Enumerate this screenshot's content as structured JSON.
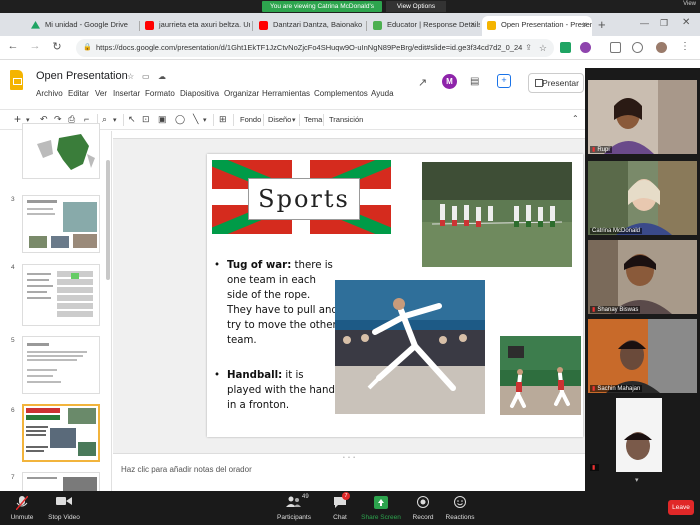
{
  "zoom_share": {
    "banner_text": "You are viewing Catrina McDonald's screen",
    "view_options": "View Options",
    "view_label": "View"
  },
  "tabs": [
    {
      "label": "Mi unidad - Google Drive",
      "icon": "google-drive-icon",
      "color": "#1fa463"
    },
    {
      "label": "jaurrieta eta axuri beltza. Urk",
      "icon": "youtube-icon",
      "color": "#ff0000"
    },
    {
      "label": "Dantzari Dantza, Baionako pe",
      "icon": "youtube-icon",
      "color": "#ff0000"
    },
    {
      "label": "Educator | Response Details",
      "icon": "educator-icon",
      "color": "#4caf50"
    },
    {
      "label": "Open Presentation - Present",
      "icon": "google-slides-icon",
      "color": "#f4b400"
    }
  ],
  "address_bar": {
    "url": "https://docs.google.com/presentation/d/1Ght1EkTF1JzCtvNoZjcFo4SHuqw9O-uInNgN89PeBrg/edit#slide=id.ge3f34cd7d2_0_24"
  },
  "slides_header": {
    "title": "Open Presentation",
    "menus": [
      "Archivo",
      "Editar",
      "Ver",
      "Insertar",
      "Formato",
      "Diapositiva",
      "Organizar",
      "Herramientas",
      "Complementos",
      "Ayuda"
    ],
    "present_label": "Presentar"
  },
  "toolbar": {
    "fondo": "Fondo",
    "diseno": "Diseño",
    "tema": "Tema",
    "transicion": "Transición"
  },
  "filmstrip": {
    "slide_numbers": [
      "3",
      "4",
      "5",
      "6",
      "7"
    ]
  },
  "slide": {
    "title": "Sports",
    "bullets": [
      {
        "bold": "Tug of war:",
        "text": " there is one team in each side of the rope. They have to pull and try to move the other team."
      },
      {
        "bold": "Handball:",
        "text": " it is played with the hand in a fronton."
      }
    ]
  },
  "notes": {
    "placeholder": "Haz clic para añadir notas del orador"
  },
  "participants": [
    {
      "name": "Rupi"
    },
    {
      "name": "Catrina McDonald"
    },
    {
      "name": "Shanay Biswas"
    },
    {
      "name": "Sachin Mahajan"
    },
    {
      "name": ""
    }
  ],
  "zoom_controls": {
    "unmute": "Unmute",
    "stop_video": "Stop Video",
    "participants": "Participants",
    "participants_count": "49",
    "chat": "Chat",
    "chat_badge": "7",
    "share_screen": "Share Screen",
    "record": "Record",
    "reactions": "Reactions",
    "leave": "Leave"
  }
}
